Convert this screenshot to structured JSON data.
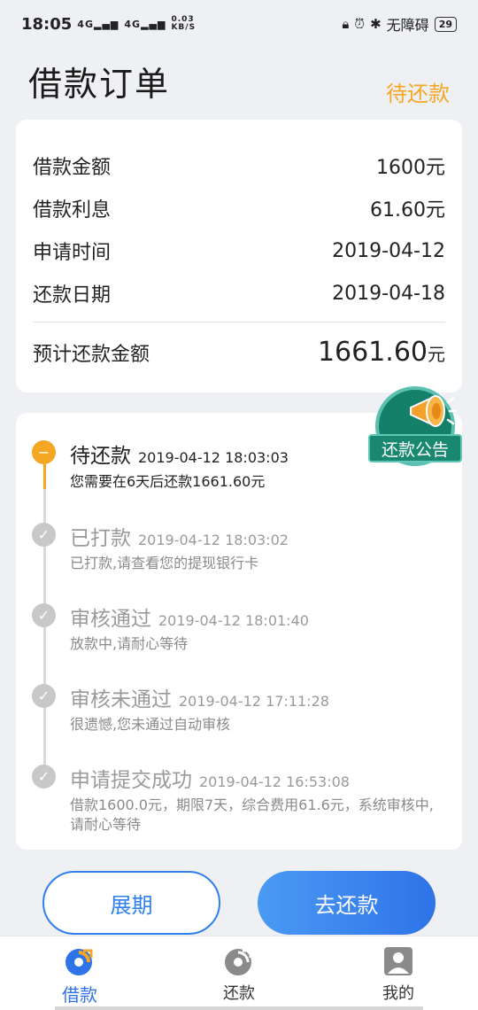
{
  "status_bar": {
    "time": "18:05",
    "signal_1": "4G",
    "signal_2": "4G",
    "speed": "0.03 KB/S",
    "carrier": "无障碍",
    "battery": "29"
  },
  "header": {
    "title": "借款订单",
    "status": "待还款"
  },
  "summary": {
    "rows": [
      {
        "label": "借款金额",
        "value": "1600元"
      },
      {
        "label": "借款利息",
        "value": "61.60元"
      },
      {
        "label": "申请时间",
        "value": "2019-04-12"
      },
      {
        "label": "还款日期",
        "value": "2019-04-18"
      }
    ],
    "total_label": "预计还款金额",
    "total_value": "1661.60",
    "total_unit": "元"
  },
  "notice": {
    "label": "还款公告",
    "icon": "megaphone-icon"
  },
  "timeline": [
    {
      "title": "待还款",
      "time": "2019-04-12 18:03:03",
      "desc": "您需要在6天后还款1661.60元",
      "state": "active"
    },
    {
      "title": "已打款",
      "time": "2019-04-12 18:03:02",
      "desc": "已打款,请查看您的提现银行卡",
      "state": "done"
    },
    {
      "title": "审核通过",
      "time": "2019-04-12 18:01:40",
      "desc": "放款中,请耐心等待",
      "state": "done"
    },
    {
      "title": "审核未通过",
      "time": "2019-04-12 17:11:28",
      "desc": "很遗憾,您未通过自动审核",
      "state": "done"
    },
    {
      "title": "申请提交成功",
      "time": "2019-04-12 16:53:08",
      "desc": "借款1600.0元，期限7天，综合费用61.6元，系统审核中,请耐心等待",
      "state": "done"
    }
  ],
  "buttons": {
    "extend": "展期",
    "repay": "去还款"
  },
  "tabbar": {
    "items": [
      {
        "label": "借款",
        "icon": "loan-icon",
        "active": true
      },
      {
        "label": "还款",
        "icon": "repay-icon",
        "active": false
      },
      {
        "label": "我的",
        "icon": "profile-icon",
        "active": false
      }
    ]
  },
  "colors": {
    "accent_orange": "#f5a623",
    "accent_blue": "#2f73e8",
    "notice_green": "#14806a"
  }
}
